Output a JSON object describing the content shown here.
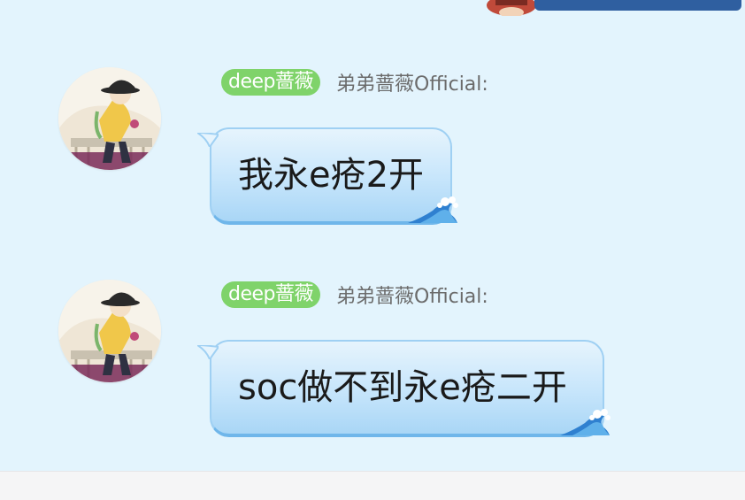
{
  "theme": {
    "background": "#e3f4fd",
    "badge_color": "#7fd36a",
    "bubble_border": "#9fd0f3",
    "bubble_bottom": "#6fb6ea",
    "top_bar": "#2f5fa0",
    "footer": "#f5f5f6"
  },
  "messages": [
    {
      "badge": "deep蔷薇",
      "sender": "弟弟蔷薇Official:",
      "text": "我永e疮2开",
      "avatar_icon": "character-avatar-icon",
      "bubble_decoration": "wave-icon"
    },
    {
      "badge": "deep蔷薇",
      "sender": "弟弟蔷薇Official:",
      "text": "soc做不到永e疮二开",
      "avatar_icon": "character-avatar-icon",
      "bubble_decoration": "wave-icon"
    }
  ]
}
